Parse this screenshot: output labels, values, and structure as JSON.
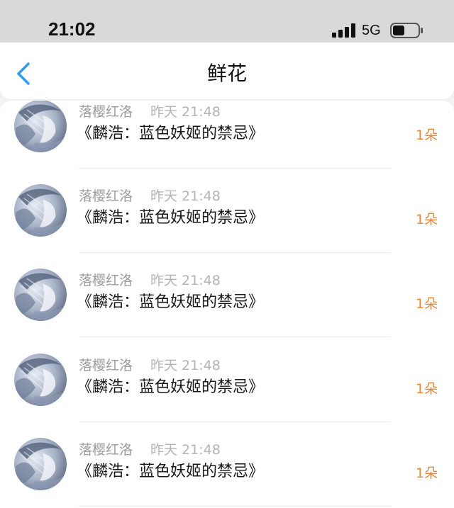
{
  "status_bar": {
    "time": "21:02",
    "network": "5G",
    "icons": [
      "signal-icon",
      "battery-icon"
    ]
  },
  "nav": {
    "back_icon": "chevron-left-icon",
    "title": "鲜花",
    "accent_color": "#2e9bf0"
  },
  "items": [
    {
      "user": "落樱红洛",
      "time": "昨天 21:48",
      "title": "《麟浩：蓝色妖姬的禁忌》",
      "count": "1朵"
    },
    {
      "user": "落樱红洛",
      "time": "昨天 21:48",
      "title": "《麟浩：蓝色妖姬的禁忌》",
      "count": "1朵"
    },
    {
      "user": "落樱红洛",
      "time": "昨天 21:48",
      "title": "《麟浩：蓝色妖姬的禁忌》",
      "count": "1朵"
    },
    {
      "user": "落樱红洛",
      "time": "昨天 21:48",
      "title": "《麟浩：蓝色妖姬的禁忌》",
      "count": "1朵"
    },
    {
      "user": "落樱红洛",
      "time": "昨天 21:48",
      "title": "《麟浩：蓝色妖姬的禁忌》",
      "count": "1朵"
    }
  ],
  "colors": {
    "count_color": "#e8883a",
    "meta_color": "#9c9c9c"
  }
}
